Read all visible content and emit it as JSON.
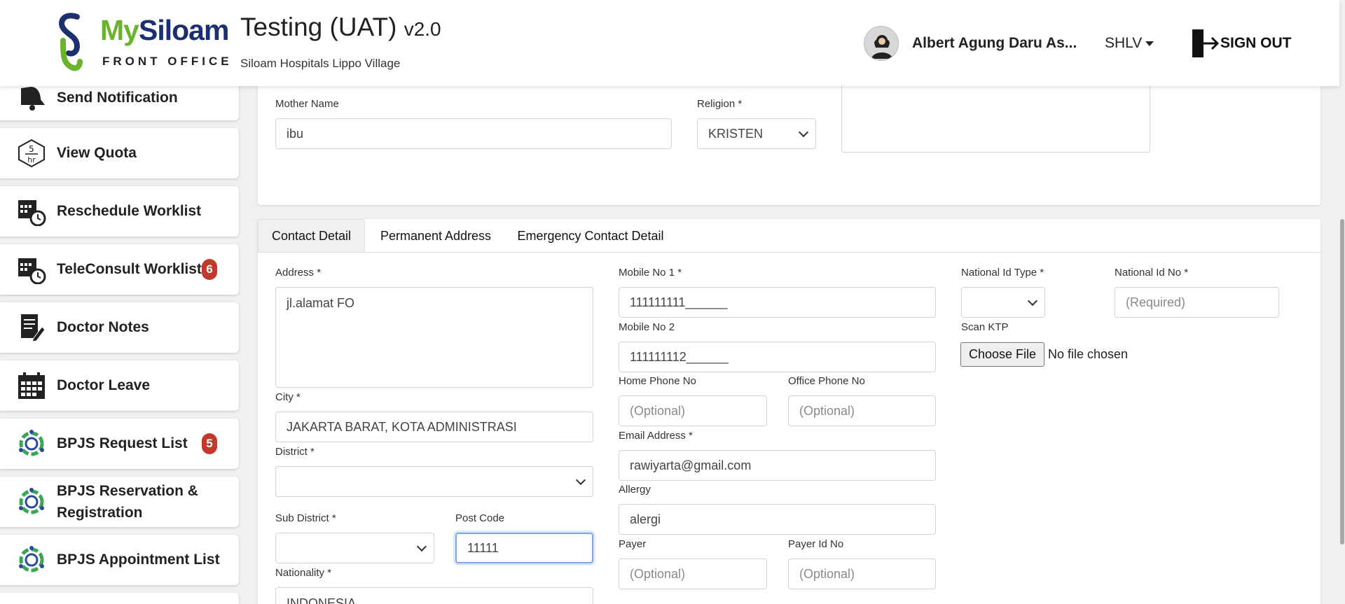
{
  "header": {
    "brand_my": "My",
    "brand_siloam": "Siloam",
    "brand_sub": "FRONT OFFICE",
    "title": "Testing (UAT)",
    "version": "v2.0",
    "hospital": "Siloam Hospitals Lippo Village",
    "user_name": "Albert Agung Daru As...",
    "hospital_code": "SHLV",
    "signout": "SIGN OUT"
  },
  "sidebar": {
    "items": [
      {
        "label": "Send Notification",
        "icon": "bell-icon"
      },
      {
        "label": "View Quota",
        "icon": "quota-icon",
        "icon_text_top": "5",
        "icon_text_bottom": "hr"
      },
      {
        "label": "Reschedule Worklist",
        "icon": "calendar-clock-icon"
      },
      {
        "label": "TeleConsult Worklist",
        "icon": "calendar-clock-icon",
        "badge": "6"
      },
      {
        "label": "Doctor Notes",
        "icon": "notes-icon"
      },
      {
        "label": "Doctor Leave",
        "icon": "calendar-icon"
      },
      {
        "label": "BPJS Request List",
        "icon": "bpjs-icon",
        "badge": "5"
      },
      {
        "label": "BPJS Reservation &",
        "label2": "Registration",
        "icon": "bpjs-icon"
      },
      {
        "label": "BPJS Appointment List",
        "icon": "bpjs-icon"
      }
    ]
  },
  "patient": {
    "mother_name_label": "Mother Name",
    "mother_name": "ibu",
    "religion_label": "Religion *",
    "religion": "KRISTEN"
  },
  "tabs": [
    "Contact Detail",
    "Permanent Address",
    "Emergency Contact Detail"
  ],
  "contact": {
    "address_label": "Address *",
    "address": "jl.alamat FO",
    "city_label": "City *",
    "city": "JAKARTA BARAT, KOTA ADMINISTRASI",
    "district_label": "District *",
    "subdistrict_label": "Sub District *",
    "postcode_label": "Post Code",
    "postcode": "11111",
    "nationality_label": "Nationality *",
    "nationality": "INDONESIA",
    "mobile1_label": "Mobile No 1 *",
    "mobile1": "111111111______",
    "mobile2_label": "Mobile No 2",
    "mobile2": "111111112______",
    "home_phone_label": "Home Phone No",
    "office_phone_label": "Office Phone No",
    "optional_placeholder": "(Optional)",
    "email_label": "Email Address *",
    "email": "rawiyarta@gmail.com",
    "allergy_label": "Allergy",
    "allergy": "alergi",
    "payer_label": "Payer",
    "payer_id_label": "Payer Id No",
    "national_id_type_label": "National Id Type *",
    "national_id_no_label": "National Id No *",
    "required_placeholder": "(Required)",
    "scan_ktp_label": "Scan KTP",
    "choose_file": "Choose File",
    "no_file": "No file chosen"
  }
}
